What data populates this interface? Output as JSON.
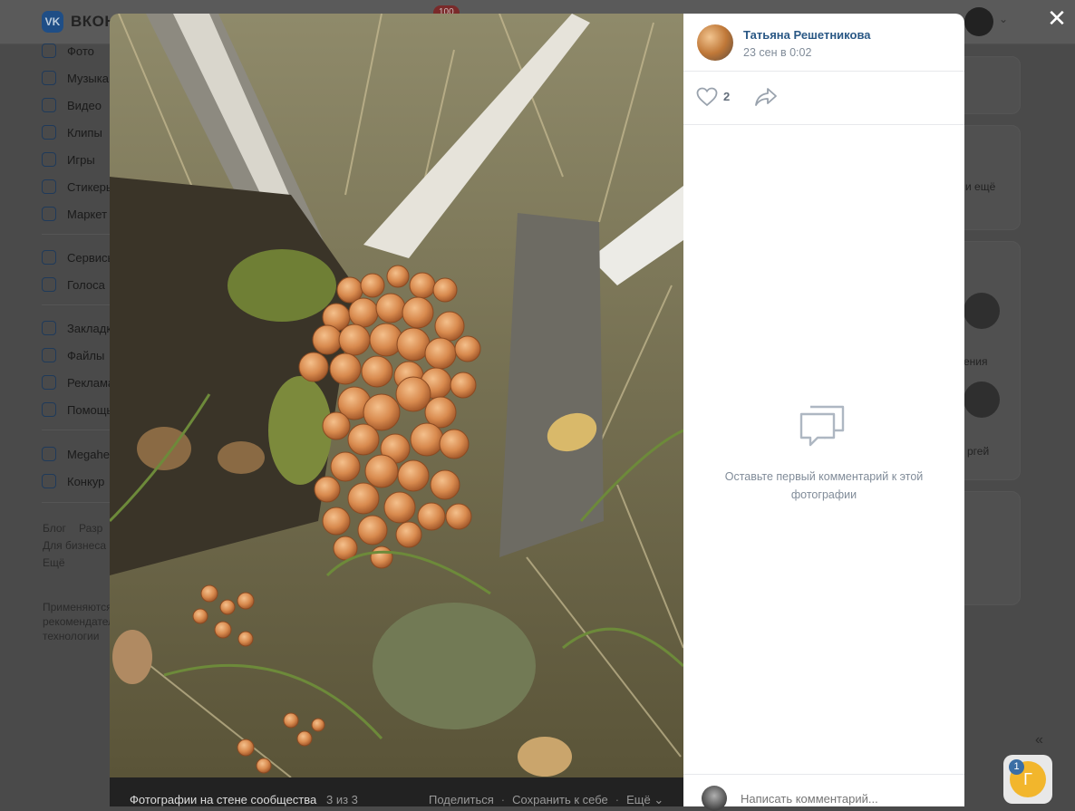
{
  "background": {
    "logo_text": "ВКОНТАКТЕ",
    "notification_badge": "100",
    "sidebar_items": [
      {
        "label": "Фото",
        "icon": "photo-icon"
      },
      {
        "label": "Музыка",
        "icon": "music-icon"
      },
      {
        "label": "Видео",
        "icon": "video-icon"
      },
      {
        "label": "Клипы",
        "icon": "clips-icon"
      },
      {
        "label": "Игры",
        "icon": "games-icon"
      },
      {
        "label": "Стикеры",
        "icon": "stickers-icon"
      },
      {
        "label": "Маркет",
        "icon": "market-icon"
      },
      {
        "label": "Сервисы",
        "icon": "services-icon"
      },
      {
        "label": "Голоса",
        "icon": "votes-icon"
      },
      {
        "label": "Закладки",
        "icon": "bookmark-icon"
      },
      {
        "label": "Файлы",
        "icon": "files-icon"
      },
      {
        "label": "Реклама",
        "icon": "ads-icon"
      },
      {
        "label": "Помощь",
        "icon": "help-icon"
      },
      {
        "label": "Megahe",
        "icon": "group-icon"
      },
      {
        "label": "Конкур",
        "icon": "group-icon"
      }
    ],
    "footer_links": [
      "Блог",
      "Разр",
      "Для бизнеса",
      "Ещё"
    ],
    "footer_note": "Применяются рекомендательные технологии",
    "right_cards": {
      "more_text": "и ещё",
      "person1": "ения",
      "person2": "ргей"
    },
    "collapse_glyph": "«",
    "messenger_count": "1",
    "messenger_letter": "Г"
  },
  "viewer": {
    "close_glyph": "✕",
    "author_name": "Татьяна Решетникова",
    "post_date": "23 сен в 0:02",
    "likes_count": "2",
    "empty_comments_text": "Оставьте первый комментарий к этой фотографии",
    "comment_placeholder": "Написать комментарий...",
    "footer": {
      "album_label": "Фотографии на стене сообщества",
      "counter": "3 из 3",
      "share_label": "Поделиться",
      "save_label": "Сохранить к себе",
      "more_label": "Ещё"
    }
  },
  "colors": {
    "link": "#2a5885",
    "secondary_text": "#818c99",
    "overlay": "#4a4a4a",
    "panel_bg": "#ffffff"
  }
}
